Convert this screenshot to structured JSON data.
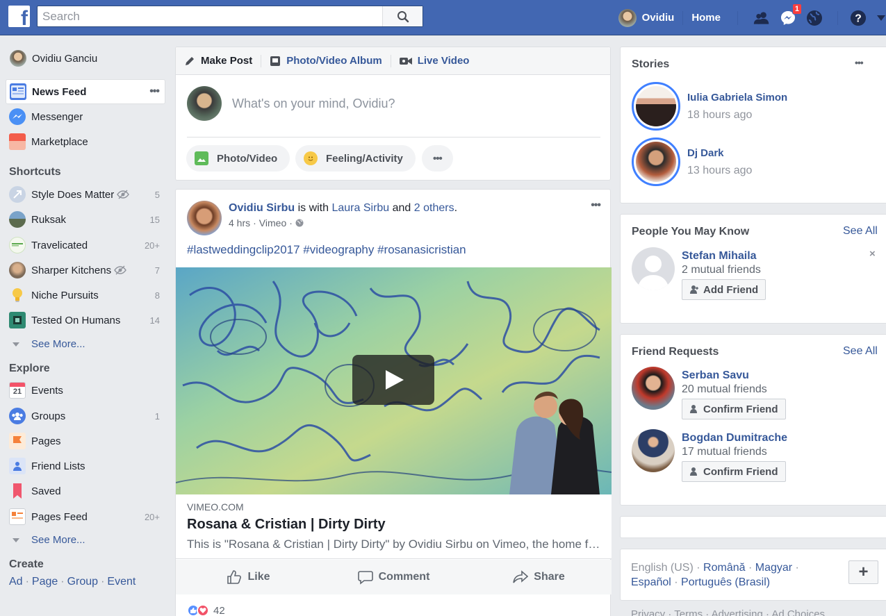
{
  "topbar": {
    "logo": "f",
    "search_placeholder": "Search",
    "user_name": "Ovidiu",
    "home_label": "Home",
    "messages_badge": "1"
  },
  "left": {
    "user_name": "Ovidiu Ganciu",
    "nav": [
      {
        "label": "News Feed"
      },
      {
        "label": "Messenger"
      },
      {
        "label": "Marketplace"
      }
    ],
    "shortcuts_title": "Shortcuts",
    "shortcuts": [
      {
        "label": "Style Does Matter",
        "count": "5"
      },
      {
        "label": "Ruksak",
        "count": "15"
      },
      {
        "label": "Travelicated",
        "count": "20+"
      },
      {
        "label": "Sharper Kitchens",
        "count": "7"
      },
      {
        "label": "Niche Pursuits",
        "count": "8"
      },
      {
        "label": "Tested On Humans",
        "count": "14"
      }
    ],
    "see_more": "See More...",
    "explore_title": "Explore",
    "explore": [
      {
        "label": "Events",
        "icon_text": "21"
      },
      {
        "label": "Groups",
        "count": "1"
      },
      {
        "label": "Pages"
      },
      {
        "label": "Friend Lists"
      },
      {
        "label": "Saved"
      },
      {
        "label": "Pages Feed",
        "count": "20+"
      }
    ],
    "create_title": "Create",
    "create_links": [
      "Ad",
      "Page",
      "Group",
      "Event"
    ]
  },
  "composer": {
    "tabs": [
      "Make Post",
      "Photo/Video Album",
      "Live Video"
    ],
    "placeholder": "What's on your mind, Ovidiu?",
    "actions": [
      "Photo/Video",
      "Feeling/Activity"
    ]
  },
  "post": {
    "author": "Ovidiu Sirbu",
    "with_text": " is with ",
    "tagged": "Laura Sirbu",
    "and_text": " and ",
    "others": "2 others",
    "period": ".",
    "time": "4 hrs",
    "via": "Vimeo",
    "text": "#lastweddingclip2017 #videography #rosanasicristian",
    "link_source": "VIMEO.COM",
    "link_title": "Rosana & Cristian | Dirty Dirty",
    "link_desc": "This is \"Rosana & Cristian | Dirty Dirty\" by Ovidiu Sirbu on Vimeo, the home for high quality videos and the people who love them.",
    "actions": [
      "Like",
      "Comment",
      "Share"
    ],
    "reaction_count": "42"
  },
  "stories": {
    "title": "Stories",
    "items": [
      {
        "name": "Iulia Gabriela Simon",
        "time": "18 hours ago"
      },
      {
        "name": "Dj Dark",
        "time": "13 hours ago"
      }
    ]
  },
  "pymk": {
    "title": "People You May Know",
    "see_all": "See All",
    "person": {
      "name": "Stefan Mihaila",
      "mutual": "2 mutual friends",
      "button": "Add Friend"
    },
    "close": "×"
  },
  "friend_requests": {
    "title": "Friend Requests",
    "see_all": "See All",
    "items": [
      {
        "name": "Serban Savu",
        "mutual": "20 mutual friends",
        "button": "Confirm Friend"
      },
      {
        "name": "Bogdan Dumitrache",
        "mutual": "17 mutual friends",
        "button": "Confirm Friend"
      }
    ]
  },
  "languages": {
    "items": [
      "English (US)",
      "Română",
      "Magyar",
      "Español",
      "Português (Brasil)"
    ],
    "plus": "+"
  },
  "footer": {
    "links": [
      "Privacy",
      "Terms",
      "Advertising",
      "Ad Choices"
    ]
  }
}
